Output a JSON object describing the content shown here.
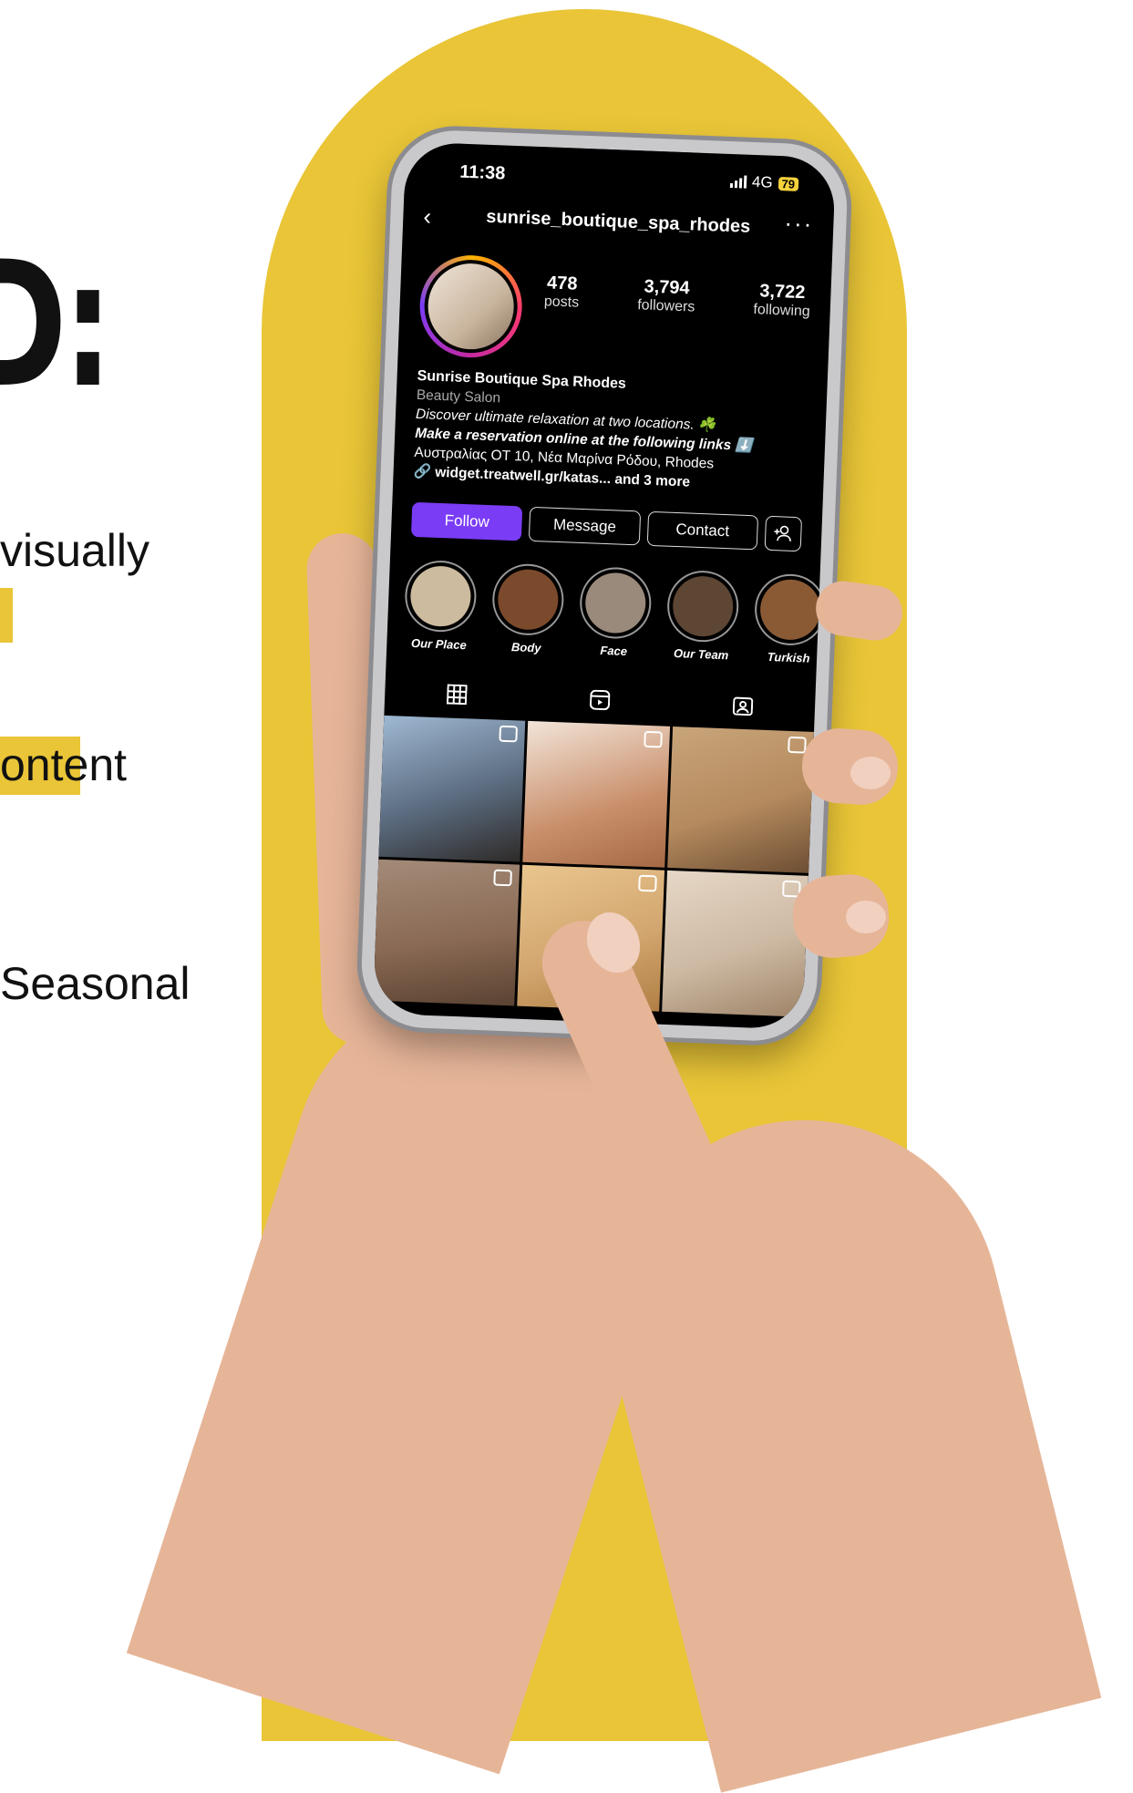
{
  "left_copy": {
    "headline": "D:",
    "line1": "visually",
    "line2": "ontent",
    "line3": "Seasonal"
  },
  "colors": {
    "accent_yellow": "#e9c537",
    "follow_purple": "#7a3cf5",
    "screen_bg": "#000000"
  },
  "status_bar": {
    "time": "11:38",
    "network": "4G",
    "battery": "79"
  },
  "profile": {
    "username": "sunrise_boutique_spa_rhodes",
    "back_icon": "chevron-left-icon",
    "more_icon": "more-horizontal-icon",
    "stats": [
      {
        "value": "478",
        "label": "posts"
      },
      {
        "value": "3,794",
        "label": "followers"
      },
      {
        "value": "3,722",
        "label": "following"
      }
    ],
    "display_name": "Sunrise Boutique Spa Rhodes",
    "category": "Beauty Salon",
    "bio_line1": "Discover ultimate relaxation at two locations. ☘️",
    "bio_line2": "Make a reservation online at the following links ⬇️",
    "bio_line3": "Αυστραλίας ΟΤ 10, Νέα Μαρίνα Ρόδου, Rhodes",
    "link_text": "widget.treatwell.gr/katas...",
    "link_more": "and 3 more"
  },
  "buttons": {
    "follow": "Follow",
    "message": "Message",
    "contact": "Contact",
    "add_user_icon": "add-user-icon"
  },
  "highlights": [
    {
      "label": "Our Place",
      "color": "#cdbb9f"
    },
    {
      "label": "Body",
      "color": "#7b4a2c"
    },
    {
      "label": "Face",
      "color": "#9a8a7b"
    },
    {
      "label": "Our Team",
      "color": "#5e4634"
    },
    {
      "label": "Turkish",
      "color": "#8a5a35"
    }
  ],
  "tabs": [
    {
      "icon": "grid-icon"
    },
    {
      "icon": "reels-icon"
    },
    {
      "icon": "tagged-icon"
    }
  ],
  "posts": [
    {
      "color": "#5b6c80"
    },
    {
      "color": "#c98f6b"
    },
    {
      "color": "#b48a5e"
    },
    {
      "color": "#8a6a54"
    },
    {
      "color": "#d3a770"
    },
    {
      "color": "#cdb9a3"
    }
  ]
}
